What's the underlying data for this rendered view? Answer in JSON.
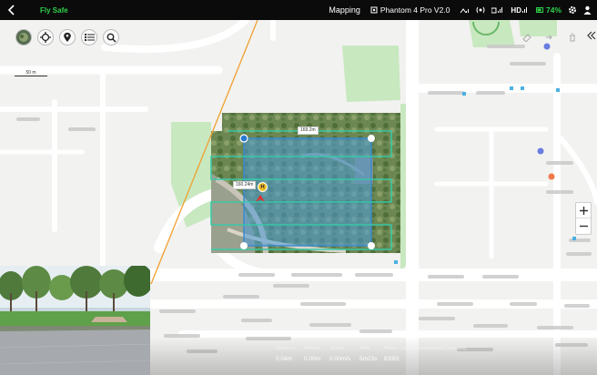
{
  "topbar": {
    "fly_safe": "Fly Safe",
    "mode": "Mapping",
    "model": "Phantom 4 Pro V2.0",
    "signal_hd": "HD",
    "battery": "74%"
  },
  "map": {
    "scale_label": "50 m",
    "width_label": "169.2m",
    "height_label": "160.24m",
    "home_marker": "H"
  },
  "stats": [
    {
      "label": "Distance",
      "value": "0.04m"
    },
    {
      "label": "Altitude",
      "value": "0.00m"
    },
    {
      "label": "Speed",
      "value": "0.00m/s"
    },
    {
      "label": "Time",
      "value": "5m23s"
    },
    {
      "label": "Photo Count (Downloaded/Captured)",
      "value": "83/83"
    }
  ],
  "colors": {
    "accent_green": "#2fd14a",
    "flight_area": "#4a9ad8",
    "flight_path": "#36c9a8",
    "no_fly_line": "#f0a030"
  }
}
